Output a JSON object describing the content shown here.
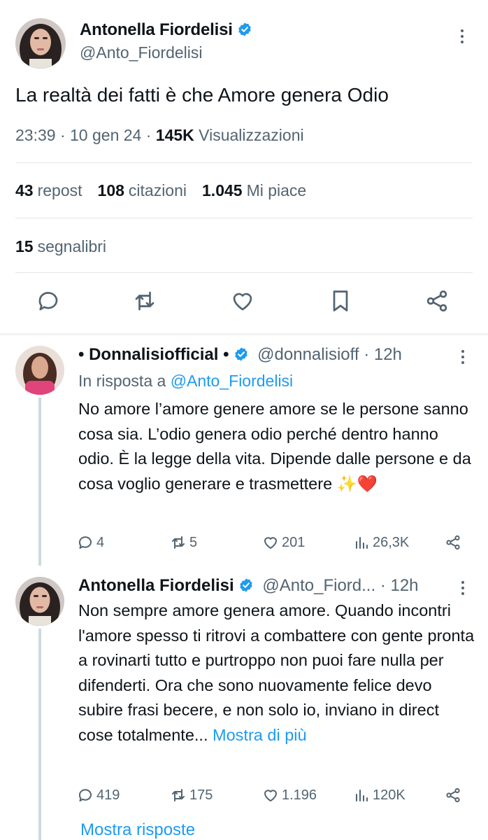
{
  "main_tweet": {
    "author_name": "Antonella Fiordelisi",
    "author_handle": "@Anto_Fiordelisi",
    "text": "La realtà dei fatti è che Amore genera Odio",
    "time": "23:39",
    "date": "10 gen 24",
    "views_count": "145K",
    "views_label": "Visualizzazioni",
    "reposts_count": "43",
    "reposts_label": "repost",
    "quotes_count": "108",
    "quotes_label": "citazioni",
    "likes_count": "1.045",
    "likes_label": "Mi piace",
    "bookmarks_count": "15",
    "bookmarks_label": "segnalibri"
  },
  "replies": [
    {
      "author_name": "• Donnalisiofficial •",
      "author_handle": "@donnalisioff",
      "time": "· 12h",
      "reply_to_label": "In risposta a",
      "reply_to_handle": "@Anto_Fiordelisi",
      "text": "No amore l’amore genere amore se le persone sanno cosa sia. L’odio genera odio perché dentro hanno odio. È la legge della vita. Dipende dalle persone e da cosa voglio generare e trasmettere ✨❤️",
      "replies_count": "4",
      "reposts_count": "5",
      "likes_count": "201",
      "views_count": "26,3K"
    },
    {
      "author_name": "Antonella Fiordelisi",
      "author_handle": "@Anto_Fiord...",
      "time": "· 12h",
      "text": "Non sempre amore genera amore. Quando incontri l'amore spesso ti ritrovi a combattere con gente pronta a rovinarti tutto e purtroppo non puoi fare nulla per difenderti. Ora che sono nuovamente felice devo subire frasi becere, e non solo io, inviano in direct cose totalmente...",
      "more_label": "Mostra di più",
      "replies_count": "419",
      "reposts_count": "175",
      "likes_count": "1.196",
      "views_count": "120K"
    }
  ],
  "show_replies_label": "Mostra risposte",
  "colors": {
    "accent": "#1d9bf0",
    "text": "#0f1419",
    "secondary": "#536471",
    "divider": "#e3e6e9"
  },
  "icons": [
    "verified-badge-icon",
    "more-options-icon",
    "reply-icon",
    "repost-icon",
    "like-icon",
    "bookmark-icon",
    "share-icon",
    "views-icon"
  ]
}
